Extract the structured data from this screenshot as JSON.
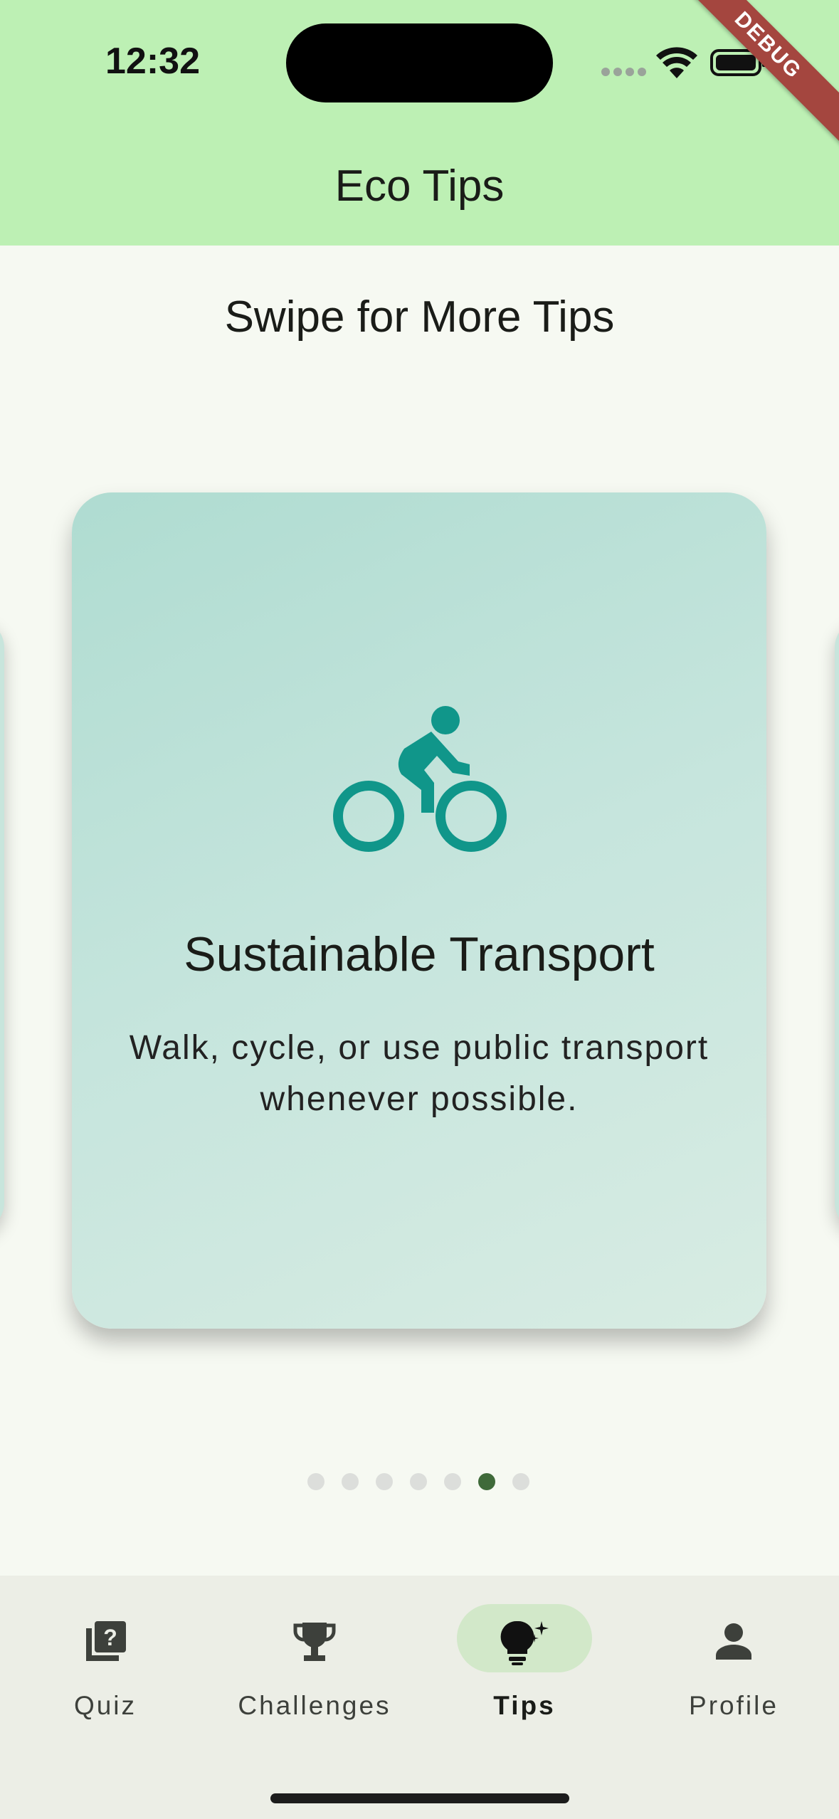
{
  "status_bar": {
    "time": "12:32"
  },
  "debug_banner": "DEBUG",
  "app_bar": {
    "title": "Eco Tips"
  },
  "heading": "Swipe for More Tips",
  "card": {
    "icon": "bike-icon",
    "title": "Sustainable Transport",
    "body": "Walk, cycle, or use public transport whenever possible."
  },
  "pager": {
    "count": 7,
    "active_index": 5
  },
  "nav": {
    "items": [
      {
        "label": "Quiz",
        "icon": "quiz-icon"
      },
      {
        "label": "Challenges",
        "icon": "trophy-icon"
      },
      {
        "label": "Tips",
        "icon": "lightbulb-icon"
      },
      {
        "label": "Profile",
        "icon": "person-icon"
      }
    ],
    "active": "Tips"
  },
  "colors": {
    "app_bar": "#bdf0b4",
    "accent": "#10968a",
    "active_dot": "#3f6a3a",
    "nav_active_pill": "#d2e8c9"
  }
}
